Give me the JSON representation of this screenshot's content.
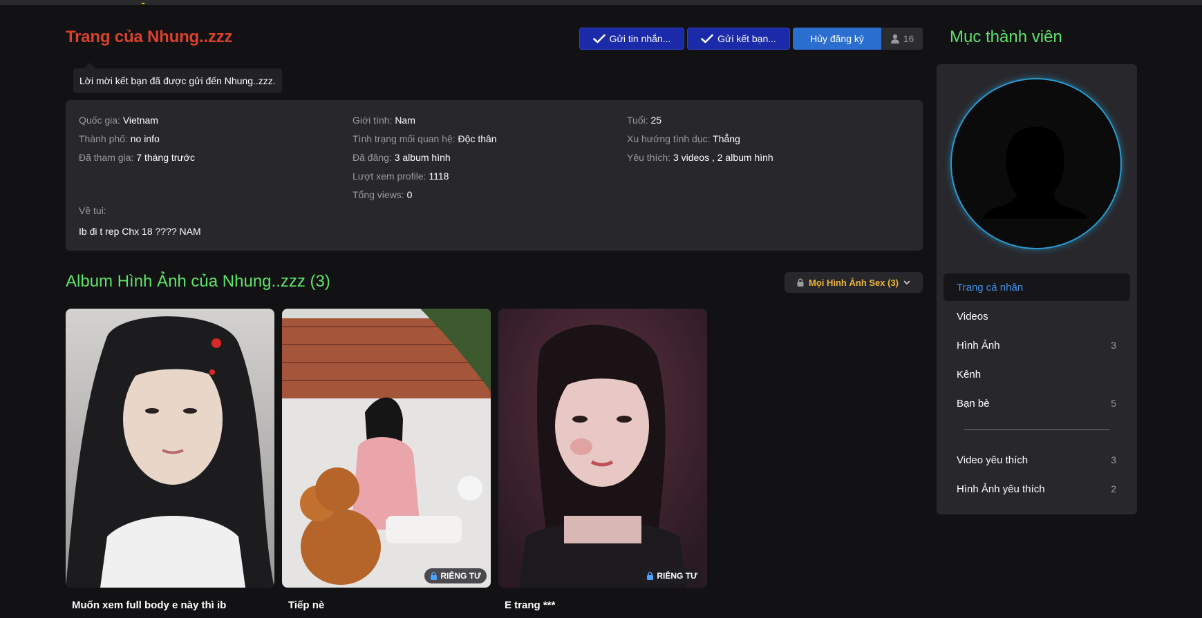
{
  "page_title": "Trang của Nhung..zzz",
  "actions": {
    "send_message": "Gửi tin nhắn...",
    "send_friend": "Gửi kết bạn...",
    "unsubscribe": "Hủy đăng ký",
    "subscriber_count": "16"
  },
  "notice": "Lời mời kết bạn đã được gửi đến Nhung..zzz.",
  "info": {
    "col1": [
      {
        "label": "Quốc gia:",
        "value": "Vietnam"
      },
      {
        "label": "Thành phố:",
        "value": "no info"
      },
      {
        "label": "Đã tham gia:",
        "value": "7 tháng trước"
      }
    ],
    "col2": [
      {
        "label": "Giới tính:",
        "value": "Nam"
      },
      {
        "label": "Tình trạng mối quan hệ:",
        "value": "Độc thân"
      },
      {
        "label": "Đã đăng:",
        "value": "3 album hình"
      },
      {
        "label": "Lượt xem profile:",
        "value": "1118"
      },
      {
        "label": "Tổng views:",
        "value": "0"
      }
    ],
    "col3": [
      {
        "label": "Tuổi:",
        "value": "25"
      },
      {
        "label": "Xu hướng tình dục:",
        "value": "Thẳng"
      },
      {
        "label": "Yêu thích:",
        "value": "3 videos , 2 album hình"
      }
    ],
    "about_label": "Về tui:",
    "about_text": "Ib đi t rep Chx 18 ???? NAM"
  },
  "album": {
    "title": "Album Hình Ảnh của Nhung..zzz (3)",
    "filter_label": "Mọi Hình Ảnh Sex (3)",
    "items": [
      {
        "caption": "Muốn xem full body e này thì ib",
        "badge": ""
      },
      {
        "caption": "Tiếp nè",
        "badge": "RIÊNG TƯ"
      },
      {
        "caption": "E trang ***",
        "badge": "RIÊNG TƯ"
      }
    ]
  },
  "sidebar": {
    "title": "Mục thành viên",
    "menu": [
      {
        "label": "Trang cá nhân",
        "count": ""
      },
      {
        "label": "Videos",
        "count": ""
      },
      {
        "label": "Hình Ảnh",
        "count": "3"
      },
      {
        "label": "Kênh",
        "count": ""
      },
      {
        "label": "Bạn bè",
        "count": "5"
      }
    ],
    "menu2": [
      {
        "label": "Video yêu thích",
        "count": "3"
      },
      {
        "label": "Hình Ảnh yêu thích",
        "count": "2"
      }
    ]
  },
  "colors": {
    "background": "#121214",
    "panel": "#28282c",
    "page_title": "#d9412b",
    "section_title": "#5fe36a",
    "primary_button": "#1a2aa8",
    "subscribe_button": "#2a6fd0",
    "active_menu": "#3d8fe8",
    "filter_text": "#f0b53a"
  },
  "icons": {
    "check": "check-icon",
    "user": "user-icon",
    "lock": "lock-icon",
    "chevron": "chevron-down-icon",
    "avatar": "default-avatar-silhouette"
  }
}
